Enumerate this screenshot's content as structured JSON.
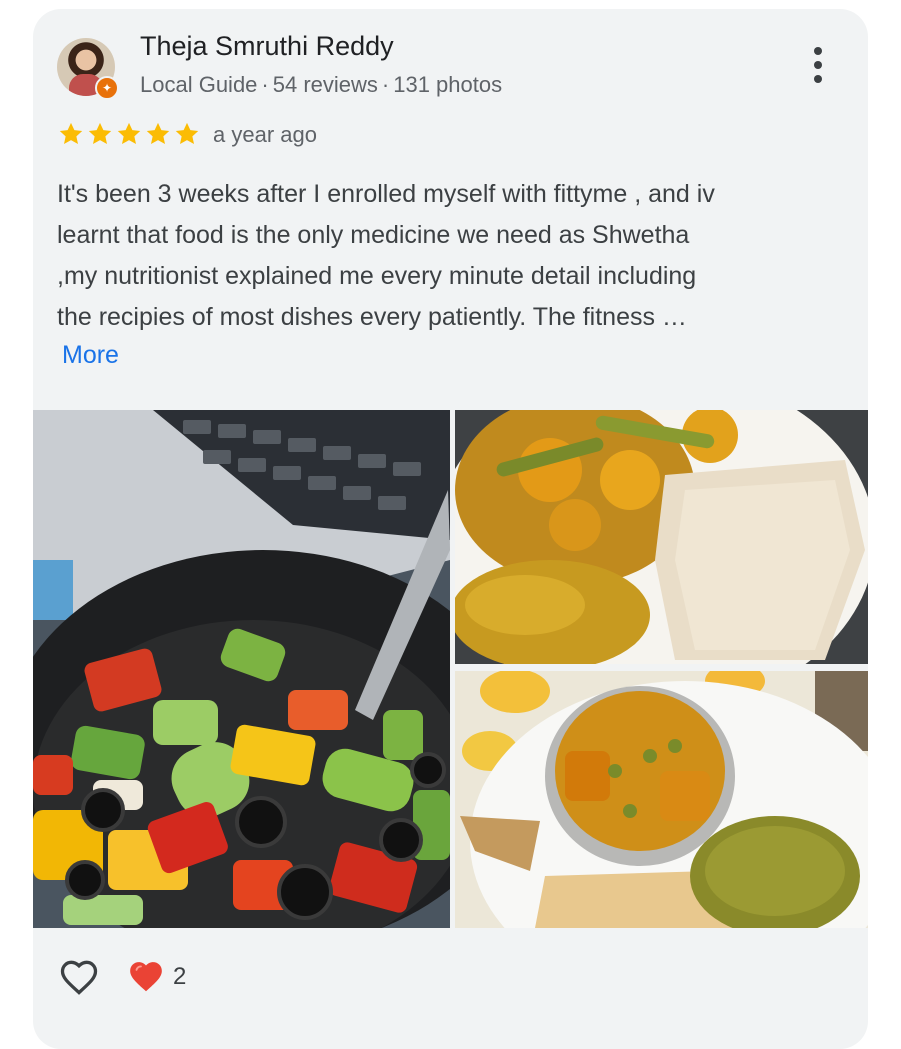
{
  "reviewer": {
    "name": "Theja Smruthi Reddy",
    "badge": "Local Guide",
    "reviews": "54 reviews",
    "photos": "131 photos"
  },
  "review": {
    "rating": 5,
    "date": "a year ago",
    "text_lines": [
      "It's been 3 weeks after I enrolled myself with fittyme , and iv",
      "learnt that food is the only medicine we need as Shwetha",
      ",my nutritionist explained me every minute detail including",
      "the recipies of most dishes every patiently. The fitness …"
    ],
    "more_label": "More"
  },
  "actions": {
    "reaction_count": "2"
  },
  "colors": {
    "star": "#fbbc04",
    "link": "#1a73e8",
    "heart": "#ea4335"
  },
  "icons": [
    "local-guide-badge-icon",
    "more-vert-icon",
    "star-icon",
    "like-heart-outline-icon",
    "heart-reaction-icon"
  ]
}
